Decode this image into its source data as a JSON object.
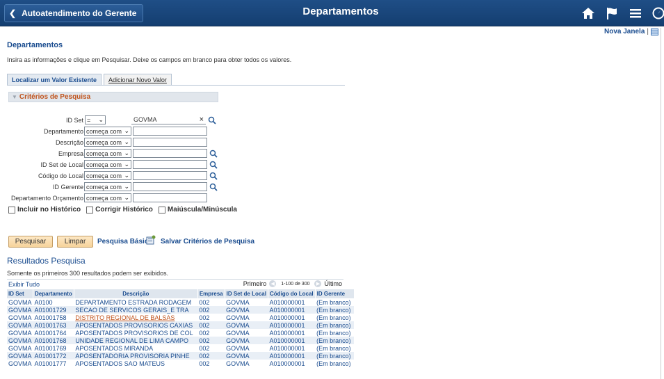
{
  "header": {
    "back_label": "Autoatendimento do Gerente",
    "title": "Departamentos",
    "icons": [
      "home-icon",
      "flag-icon",
      "menu-icon",
      "navbar-icon"
    ]
  },
  "top_links": {
    "new_window": "Nova Janela",
    "separator": "|"
  },
  "page": {
    "title": "Departamentos",
    "instruction": "Insira as informações e clique em Pesquisar. Deixe os campos em branco para obter todos os valores."
  },
  "tabs": [
    "Localizar um Valor Existente",
    "Adicionar Novo Valor"
  ],
  "criteria": {
    "section_label": "Critérios de Pesquisa",
    "fields": [
      {
        "label": "ID Set",
        "operator": "=",
        "value": "GOVMA"
      },
      {
        "label": "Departamento",
        "operator": "começa com",
        "value": ""
      },
      {
        "label": "Descrição",
        "operator": "começa com",
        "value": ""
      },
      {
        "label": "Empresa",
        "operator": "começa com",
        "value": ""
      },
      {
        "label": "ID Set de Local",
        "operator": "começa com",
        "value": ""
      },
      {
        "label": "Código do Local",
        "operator": "começa com",
        "value": ""
      },
      {
        "label": "ID Gerente",
        "operator": "começa com",
        "value": ""
      },
      {
        "label": "Departamento Orçamento",
        "operator": "começa com",
        "value": ""
      }
    ],
    "checkboxes": [
      "Incluir no Histórico",
      "Corrigir Histórico",
      "Maiúscula/Minúscula"
    ]
  },
  "actions": {
    "search": "Pesquisar",
    "clear": "Limpar",
    "basic_search": "Pesquisa Básica",
    "save_criteria": "Salvar Critérios de Pesquisa"
  },
  "results": {
    "title": "Resultados Pesquisa",
    "note": "Somente os primeiros 300 resultados podem ser exibidos.",
    "show_all": "Exibir Tudo",
    "pager": {
      "first": "Primeiro",
      "range": "1-100 de 300",
      "last": "Último"
    },
    "columns": [
      "ID Set",
      "Departamento",
      "Descrição",
      "Empresa",
      "ID Set de Local",
      "Código do Local",
      "ID Gerente"
    ],
    "rows": [
      [
        "GOVMA",
        "A0100",
        "DEPARTAMENTO ESTRADA RODAGEM",
        "002",
        "GOVMA",
        "A010000001",
        "(Em branco)"
      ],
      [
        "GOVMA",
        "A01001729",
        "SECAO DE SERVICOS GERAIS_E TRA",
        "002",
        "GOVMA",
        "A010000001",
        "(Em branco)"
      ],
      [
        "GOVMA",
        "A01001758",
        "DISTRITO REGIONAL DE BALSAS",
        "002",
        "GOVMA",
        "A010000001",
        "(Em branco)"
      ],
      [
        "GOVMA",
        "A01001763",
        "APOSENTADOS PROVISORIOS CAXIAS",
        "002",
        "GOVMA",
        "A010000001",
        "(Em branco)"
      ],
      [
        "GOVMA",
        "A01001764",
        "APOSENTADOS PROVISORIOS DE COL",
        "002",
        "GOVMA",
        "A010000001",
        "(Em branco)"
      ],
      [
        "GOVMA",
        "A01001768",
        "UNIDADE REGIONAL DE LIMA CAMPO",
        "002",
        "GOVMA",
        "A010000001",
        "(Em branco)"
      ],
      [
        "GOVMA",
        "A01001769",
        "APOSENTADOS MIRANDA",
        "002",
        "GOVMA",
        "A010000001",
        "(Em branco)"
      ],
      [
        "GOVMA",
        "A01001772",
        "APOSENTADORIA PROVISORIA PINHE",
        "002",
        "GOVMA",
        "A010000001",
        "(Em branco)"
      ],
      [
        "GOVMA",
        "A01001777",
        "APOSENTADOS SAO MATEUS",
        "002",
        "GOVMA",
        "A010000001",
        "(Em branco)"
      ]
    ],
    "highlighted_row": 2
  },
  "colors": {
    "header_bg": "#1b477e",
    "link": "#1a4c8f",
    "accent_orange": "#c0531c",
    "button_bg": "#f6d39b"
  }
}
